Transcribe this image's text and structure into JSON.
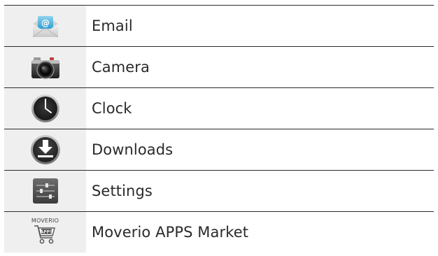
{
  "apps": [
    {
      "label": "Email",
      "icon": "email-icon"
    },
    {
      "label": "Camera",
      "icon": "camera-icon"
    },
    {
      "label": "Clock",
      "icon": "clock-icon"
    },
    {
      "label": "Downloads",
      "icon": "downloads-icon"
    },
    {
      "label": "Settings",
      "icon": "settings-icon"
    },
    {
      "label": "Moverio APPS Market",
      "icon": "moverio-apps-market-icon",
      "icon_text_top": "MOVERIO",
      "icon_text_badge": "APPS"
    }
  ]
}
